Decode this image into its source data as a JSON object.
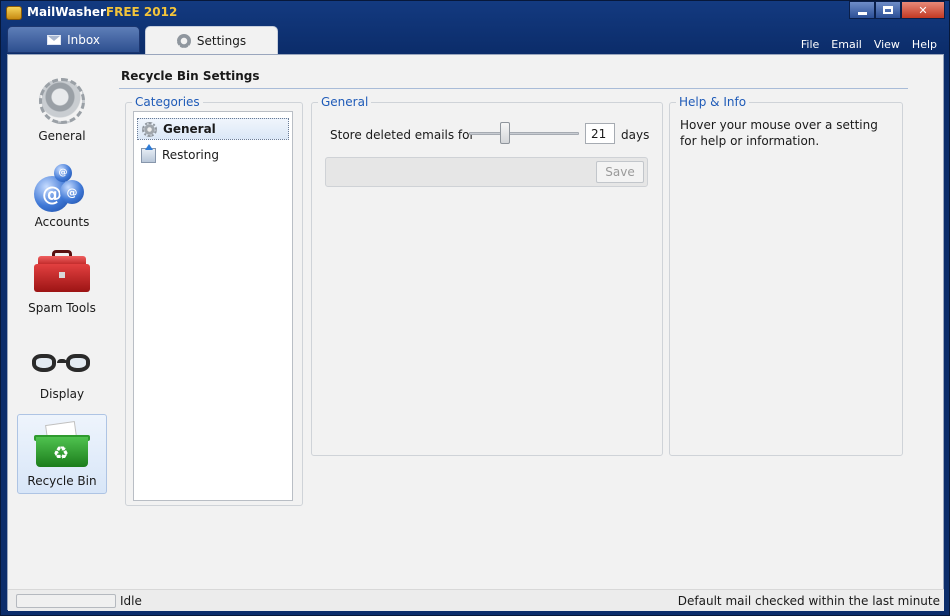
{
  "window": {
    "title_main": "MailWasher",
    "title_free": "FREE 2012"
  },
  "tabs": [
    {
      "label": "Inbox",
      "icon": "envelope-icon"
    },
    {
      "label": "Settings",
      "icon": "gear-icon"
    }
  ],
  "menu": [
    "File",
    "Email",
    "View",
    "Help"
  ],
  "nav": [
    {
      "label": "General",
      "icon": "gear-icon"
    },
    {
      "label": "Accounts",
      "icon": "accounts-icon"
    },
    {
      "label": "Spam Tools",
      "icon": "toolbox-icon"
    },
    {
      "label": "Display",
      "icon": "glasses-icon"
    },
    {
      "label": "Recycle Bin",
      "icon": "recycle-bin-icon",
      "selected": true
    }
  ],
  "page": {
    "title": "Recycle Bin Settings"
  },
  "categories": {
    "label": "Categories",
    "items": [
      {
        "label": "General",
        "selected": true
      },
      {
        "label": "Restoring"
      }
    ]
  },
  "general": {
    "label": "General",
    "setting_label": "Store deleted emails for",
    "days_value": "21",
    "days_unit": "days",
    "save_label": "Save"
  },
  "help": {
    "label": "Help & Info",
    "text": "Hover your mouse over a setting for help or information."
  },
  "status": {
    "left": "Idle",
    "right": "Default mail checked within the last minute"
  },
  "colors": {
    "accent": "#1f5bb8",
    "window_frame": "#0c2d6b",
    "close_button": "#c23a24"
  }
}
